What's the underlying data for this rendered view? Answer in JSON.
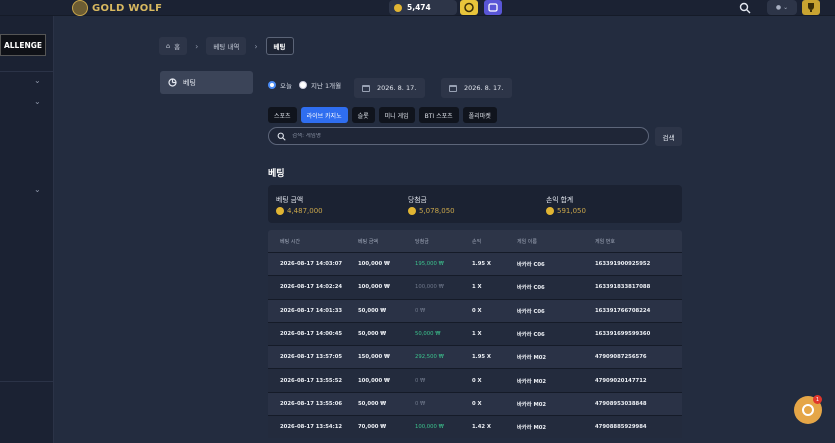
{
  "header": {
    "logo_text": "GOLD WOLF",
    "balance": "5,474"
  },
  "sidebar": {
    "banner": "ALLENGE"
  },
  "breadcrumb": [
    "홈",
    "베팅 내역",
    "베팅"
  ],
  "subnav": {
    "label": "베팅"
  },
  "filters": {
    "radio_today": "오늘",
    "radio_month": "지난 1개월",
    "date_from": "2026. 8. 17.",
    "date_to": "2026. 8. 17."
  },
  "tabs": [
    "스포츠",
    "라이브 카지노",
    "슬롯",
    "미니 게임",
    "BTI 스포츠",
    "폴리마켓"
  ],
  "active_tab": "라이브 카지노",
  "search": {
    "placeholder": "검색: 게임명",
    "button": "검색"
  },
  "section_title": "베팅",
  "summary": [
    {
      "label": "베팅 금액",
      "value": "4,487,000"
    },
    {
      "label": "당첨금",
      "value": "5,078,050"
    },
    {
      "label": "손익 합계",
      "value": "591,050"
    }
  ],
  "table": {
    "headers": [
      "베팅 시간",
      "베팅 금액",
      "당첨금",
      "손익",
      "게임 이름",
      "게임 번호"
    ],
    "rows": [
      [
        "2026-08-17 14:03:07",
        "100,000 ₩",
        "195,000 ₩",
        "1.95 X",
        "바카라 C06",
        "163391900925952"
      ],
      [
        "2026-08-17 14:02:24",
        "100,000 ₩",
        "100,000 ₩",
        "1 X",
        "바카라 C06",
        "163391833817088"
      ],
      [
        "2026-08-17 14:01:33",
        "50,000 ₩",
        "0 ₩",
        "0 X",
        "바카라 C06",
        "163391766708224"
      ],
      [
        "2026-08-17 14:00:45",
        "50,000 ₩",
        "50,000 ₩",
        "1 X",
        "바카라 C06",
        "163391699599360"
      ],
      [
        "2026-08-17 13:57:05",
        "150,000 ₩",
        "292,500 ₩",
        "1.95 X",
        "바카라 M02",
        "47909087256576"
      ],
      [
        "2026-08-17 13:55:52",
        "100,000 ₩",
        "0 ₩",
        "0 X",
        "바카라 M02",
        "47909020147712"
      ],
      [
        "2026-08-17 13:55:06",
        "50,000 ₩",
        "0 ₩",
        "0 X",
        "바카라 M02",
        "47908953038848"
      ],
      [
        "2026-08-17 13:54:12",
        "70,000 ₩",
        "100,000 ₩",
        "1.42 X",
        "바카라 M02",
        "47908885929984"
      ]
    ],
    "payout_color": [
      "win",
      "zero",
      "zero",
      "win",
      "win",
      "zero",
      "zero",
      "win"
    ]
  },
  "chat": {
    "badge": "1"
  }
}
